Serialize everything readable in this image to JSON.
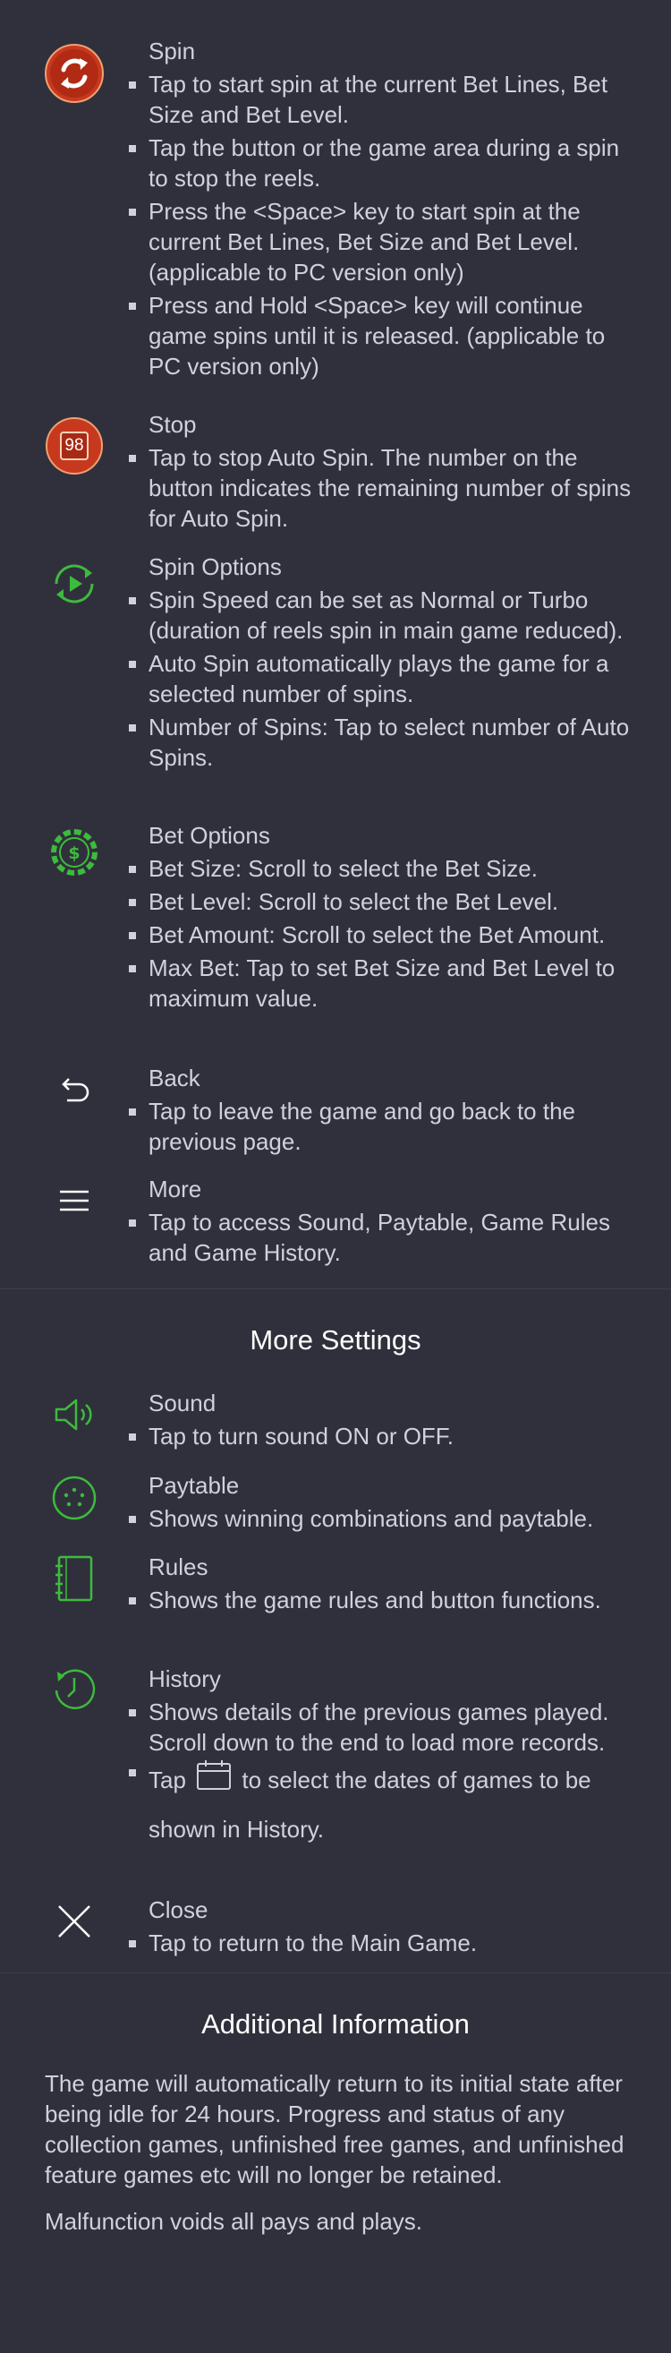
{
  "controls": [
    {
      "icon": "spin-icon",
      "title": "Spin",
      "bullets": [
        "Tap to start spin at the current Bet Lines, Bet Size and Bet Level.",
        "Tap the button or the game area during a spin to stop the reels.",
        "Press the <Space> key to start spin at the current Bet Lines, Bet Size and Bet Level. (applicable to PC version only)",
        "Press and Hold <Space> key will continue game spins until it is released. (applicable to PC version only)"
      ]
    },
    {
      "icon": "stop-icon",
      "badge": "98",
      "title": "Stop",
      "bullets": [
        "Tap to stop Auto Spin. The number on the button indicates the remaining number of spins for Auto Spin."
      ]
    },
    {
      "icon": "spin-options-icon",
      "title": "Spin Options",
      "bullets": [
        "Spin Speed can be set as Normal or Turbo (duration of reels spin in main game reduced).",
        "Auto Spin automatically plays the game for a selected number of spins.",
        "Number of Spins: Tap to select number of Auto Spins."
      ]
    },
    {
      "icon": "bet-options-icon",
      "title": "Bet Options",
      "bullets": [
        "Bet Size: Scroll to select the Bet Size.",
        "Bet Level: Scroll to select the Bet Level.",
        "Bet Amount: Scroll to select the Bet Amount.",
        "Max Bet: Tap to set Bet Size and Bet Level to maximum value."
      ]
    },
    {
      "icon": "back-icon",
      "title": "Back",
      "bullets": [
        "Tap to leave the game and go back to the previous page."
      ]
    },
    {
      "icon": "menu-icon",
      "title": "More",
      "bullets": [
        "Tap to access Sound, Paytable, Game Rules and Game History."
      ]
    }
  ],
  "more_settings": {
    "heading": "More Settings",
    "sound": {
      "title": "Sound",
      "bullet": "Tap to turn sound ON or OFF."
    },
    "paytable": {
      "title": "Paytable",
      "bullet": "Shows winning combinations and paytable."
    },
    "rules": {
      "title": "Rules",
      "bullet": "Shows the game rules and button functions."
    },
    "history": {
      "title": "History",
      "bullet1": "Shows details of the previous games played. Scroll down to the end to load more records.",
      "bullet2_pre": "Tap",
      "bullet2_post": "to select the dates of games to be shown in History."
    },
    "close": {
      "title": "Close",
      "bullet": "Tap to return to the Main Game."
    }
  },
  "additional": {
    "heading": "Additional Information",
    "para1": "The game will automatically return to its initial state after being idle for 24 hours. Progress and status of any collection games, unfinished free games, and unfinished feature games etc will no longer be retained.",
    "para2": "Malfunction voids all pays and plays."
  },
  "colors": {
    "background": "#30303c",
    "text": "#cfd1de",
    "heading": "#ffffff",
    "accent_green": "#3dbb3c",
    "spin_red": "#c7391f"
  }
}
